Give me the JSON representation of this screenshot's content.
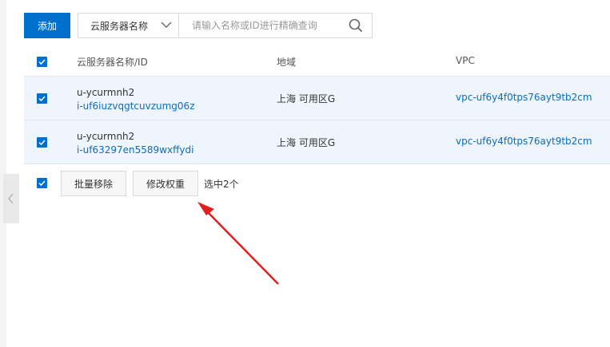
{
  "toolbar": {
    "add_label": "添加",
    "search_field_selected": "云服务器名称",
    "search_placeholder": "请输入名称或ID进行精确查询"
  },
  "table": {
    "columns": [
      "云服务器名称/ID",
      "地域",
      "VPC"
    ],
    "rows": [
      {
        "name": "u-ycurmnh2",
        "id": "i-uf6iuzvqgtcuvzumg06z",
        "region": "上海 可用区G",
        "vpc": "vpc-uf6y4f0tps76ayt9tb2cm",
        "checked": true
      },
      {
        "name": "u-ycurmnh2",
        "id": "i-uf63297en5589wxffydi",
        "region": "上海 可用区G",
        "vpc": "vpc-uf6y4f0tps76ayt9tb2cm",
        "checked": true
      }
    ]
  },
  "footer": {
    "batch_remove_label": "批量移除",
    "modify_weight_label": "修改权重",
    "selected_text": "选中2个"
  },
  "colors": {
    "primary": "#0070cc",
    "link": "#0a6cc0",
    "selected_row": "#eef5fd",
    "annotation_arrow": "#e02020"
  },
  "icons": {
    "search": "search-icon",
    "dropdown": "chevron-down-icon",
    "collapse": "chevron-left-icon",
    "checkbox": "checkbox-checked-icon"
  }
}
